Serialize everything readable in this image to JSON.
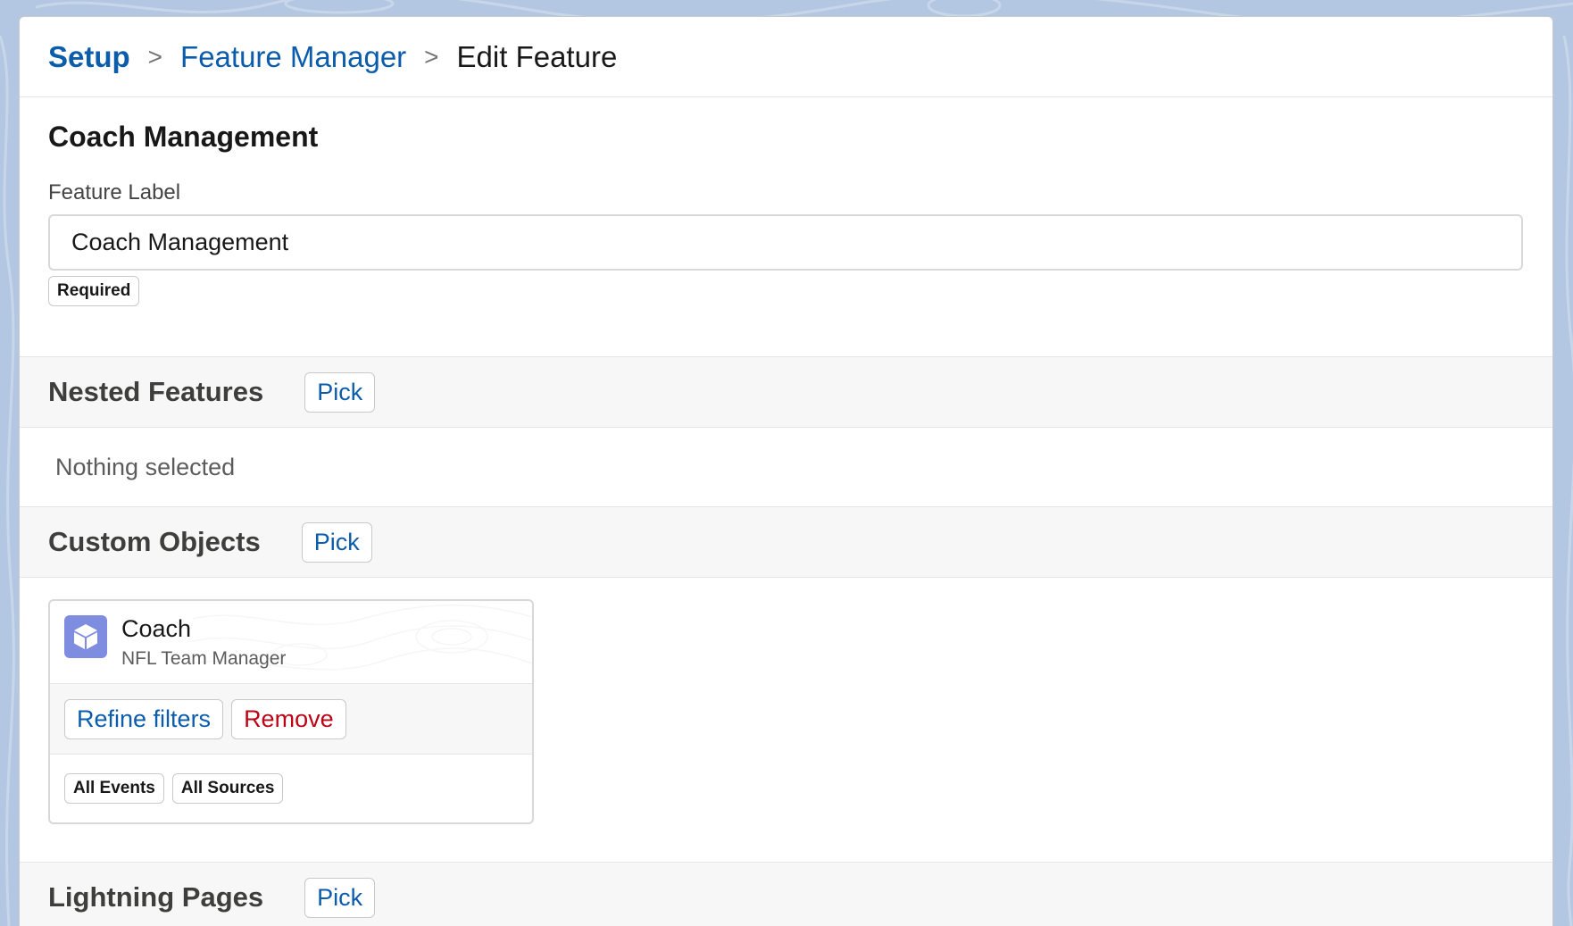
{
  "breadcrumb": {
    "root": "Setup",
    "separator": ">",
    "parent": "Feature Manager",
    "current": "Edit Feature"
  },
  "form": {
    "title": "Coach Management",
    "feature_label": "Feature Label",
    "feature_value": "Coach Management",
    "required_badge": "Required"
  },
  "nested_features": {
    "title": "Nested Features",
    "pick_label": "Pick",
    "empty_text": "Nothing selected"
  },
  "custom_objects": {
    "title": "Custom Objects",
    "pick_label": "Pick",
    "items": [
      {
        "name": "Coach",
        "subtitle": "NFL Team Manager",
        "icon": "cube-icon",
        "refine_label": "Refine filters",
        "remove_label": "Remove",
        "tags": [
          "All Events",
          "All Sources"
        ]
      }
    ]
  },
  "lightning_pages": {
    "title": "Lightning Pages",
    "pick_label": "Pick"
  },
  "colors": {
    "link": "#0b5cab",
    "destructive": "#ba0517",
    "object_icon": "#7f8de1",
    "page_background": "#b3c7e2"
  }
}
